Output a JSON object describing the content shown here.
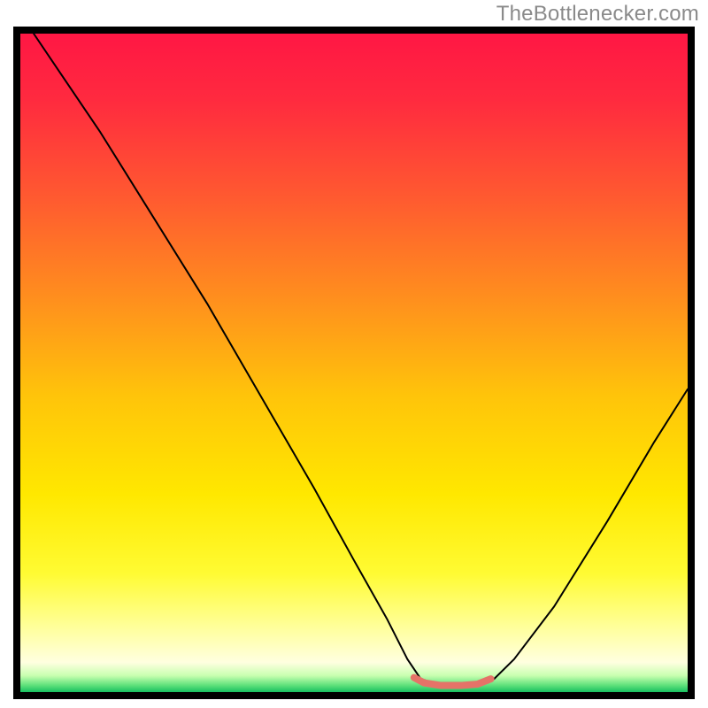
{
  "watermark": "TheBottlenecker.com",
  "chart_data": {
    "type": "line",
    "title": "",
    "xlabel": "",
    "ylabel": "",
    "xlim": [
      0,
      100
    ],
    "ylim": [
      0,
      100
    ],
    "background_gradient": {
      "stops": [
        {
          "offset": 0.0,
          "color": "#ff1744"
        },
        {
          "offset": 0.1,
          "color": "#ff2a3f"
        },
        {
          "offset": 0.25,
          "color": "#ff5a30"
        },
        {
          "offset": 0.4,
          "color": "#ff8e1e"
        },
        {
          "offset": 0.55,
          "color": "#ffc40a"
        },
        {
          "offset": 0.7,
          "color": "#ffe800"
        },
        {
          "offset": 0.82,
          "color": "#fffb33"
        },
        {
          "offset": 0.9,
          "color": "#ffff99"
        },
        {
          "offset": 0.955,
          "color": "#ffffe0"
        },
        {
          "offset": 0.975,
          "color": "#c8ffb0"
        },
        {
          "offset": 0.99,
          "color": "#5de07a"
        },
        {
          "offset": 1.0,
          "color": "#18c060"
        }
      ]
    },
    "series": [
      {
        "name": "bottleneck-curve",
        "color": "#000000",
        "stroke_width": 2,
        "points": [
          {
            "x": 2.0,
            "y": 100.0
          },
          {
            "x": 6.0,
            "y": 94.0
          },
          {
            "x": 12.0,
            "y": 85.0
          },
          {
            "x": 20.0,
            "y": 72.0
          },
          {
            "x": 28.0,
            "y": 59.0
          },
          {
            "x": 36.0,
            "y": 45.0
          },
          {
            "x": 44.0,
            "y": 31.0
          },
          {
            "x": 50.0,
            "y": 20.0
          },
          {
            "x": 55.0,
            "y": 11.0
          },
          {
            "x": 58.0,
            "y": 5.0
          },
          {
            "x": 60.0,
            "y": 2.0
          },
          {
            "x": 63.0,
            "y": 1.0
          },
          {
            "x": 68.0,
            "y": 1.0
          },
          {
            "x": 71.0,
            "y": 2.0
          },
          {
            "x": 74.0,
            "y": 5.0
          },
          {
            "x": 80.0,
            "y": 13.0
          },
          {
            "x": 88.0,
            "y": 26.0
          },
          {
            "x": 95.0,
            "y": 38.0
          },
          {
            "x": 100.0,
            "y": 46.0
          }
        ]
      },
      {
        "name": "optimal-range-marker",
        "color": "#e57368",
        "stroke_width": 8,
        "points": [
          {
            "x": 59.0,
            "y": 2.2
          },
          {
            "x": 60.5,
            "y": 1.4
          },
          {
            "x": 63.0,
            "y": 1.0
          },
          {
            "x": 66.0,
            "y": 1.0
          },
          {
            "x": 68.5,
            "y": 1.2
          },
          {
            "x": 70.5,
            "y": 2.0
          }
        ]
      }
    ]
  }
}
